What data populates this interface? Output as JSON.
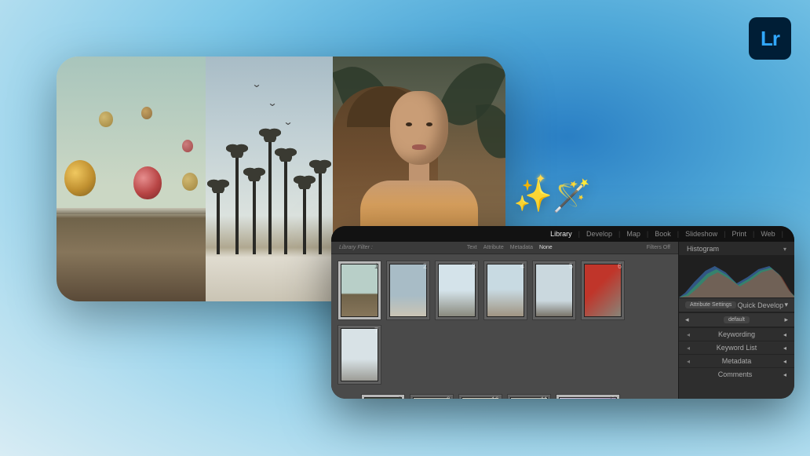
{
  "app": {
    "logo_text": "Lr"
  },
  "emoji": {
    "wand": "🪄",
    "sparkle": "✨"
  },
  "modules": {
    "items": [
      "Library",
      "Develop",
      "Map",
      "Book",
      "Slideshow",
      "Print",
      "Web"
    ],
    "active": "Library",
    "separator": "|"
  },
  "filter_bar": {
    "label": "Library Filter :",
    "tabs": [
      "Text",
      "Attribute",
      "Metadata",
      "None"
    ],
    "active_tab": "None",
    "right_label": "Filters Off"
  },
  "grid": {
    "thumbs": [
      {
        "index": 1,
        "selected": true
      },
      {
        "index": 2,
        "selected": false
      },
      {
        "index": 3,
        "selected": false
      },
      {
        "index": 4,
        "selected": false
      },
      {
        "index": 5,
        "selected": false
      },
      {
        "index": 6,
        "selected": false
      },
      {
        "index": 7,
        "selected": false
      },
      {
        "index": 8,
        "selected": true
      },
      {
        "index": 9,
        "selected": false
      },
      {
        "index": 10,
        "selected": false
      },
      {
        "index": 11,
        "selected": false
      },
      {
        "index": 12,
        "selected": true
      }
    ]
  },
  "right_panel": {
    "histogram_title": "Histogram",
    "qd_header_left": "Attribute Settings",
    "qd_title": "Quick Develop",
    "qd_sub_left": "default",
    "sections": {
      "keywording": "Keywording",
      "keyword_list": "Keyword List",
      "metadata": "Metadata",
      "comments": "Comments"
    }
  }
}
